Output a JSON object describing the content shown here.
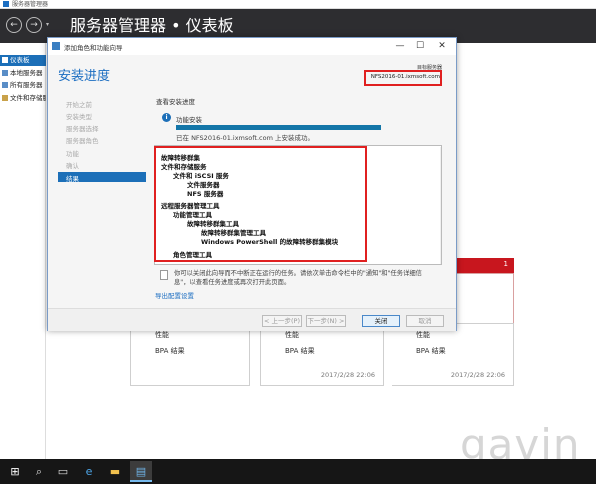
{
  "server_manager": {
    "window_title": "服务器管理器",
    "header_title": "服务器管理器 • 仪表板",
    "sidebar": [
      {
        "label": "仪表板",
        "active": true
      },
      {
        "label": "本地服务器",
        "active": false
      },
      {
        "label": "所有服务器",
        "active": false
      },
      {
        "label": "文件和存储服务",
        "active": false
      }
    ],
    "tiles": [
      {
        "line1": "性能",
        "line2": "BPA 结果",
        "timestamp": ""
      },
      {
        "line1": "性能",
        "line2": "BPA 结果",
        "timestamp": "2017/2/28 22:06"
      },
      {
        "line1": "性能",
        "line2": "BPA 结果",
        "timestamp": "2017/2/28 22:06"
      }
    ],
    "alert_count": "1"
  },
  "wizard": {
    "title": "添加角色和功能向导",
    "heading": "安装进度",
    "target_label": "目标服务器",
    "target_server": "NFS2016-01.ixmsoft.com",
    "steps": [
      "开始之前",
      "安装类型",
      "服务器选择",
      "服务器角色",
      "功能",
      "确认",
      "结果"
    ],
    "active_step": "结果",
    "view_progress": "查看安装进度",
    "feature_install": "功能安装",
    "progress": 1.0,
    "install_status": "已在 NFS2016-01.ixmsoft.com 上安装成功。",
    "results": [
      "故障转移群集",
      "文件和存储服务",
      "文件和 iSCSI 服务",
      "文件服务器",
      "NFS 服务器",
      "远程服务器管理工具",
      "功能管理工具",
      "故障转移群集工具",
      "故障转移群集管理工具",
      "Windows PowerShell 的故障转移群集模块",
      "角色管理工具"
    ],
    "note": "你可以关闭此向导而不中断正在运行的任务。请依次单击命令栏中的\"通知\"和\"任务详细信息\"，以查看任务进度或再次打开此页面。",
    "export_link": "导出配置设置",
    "buttons": {
      "prev": "< 上一步(P)",
      "next": "下一步(N) >",
      "close": "关闭",
      "cancel": "取消"
    }
  },
  "watermark": "gavin",
  "colors": {
    "accent": "#1c6fb8",
    "header": "#2d2d30",
    "highlight_box": "#e02020",
    "alert_tile": "#c8161e"
  }
}
